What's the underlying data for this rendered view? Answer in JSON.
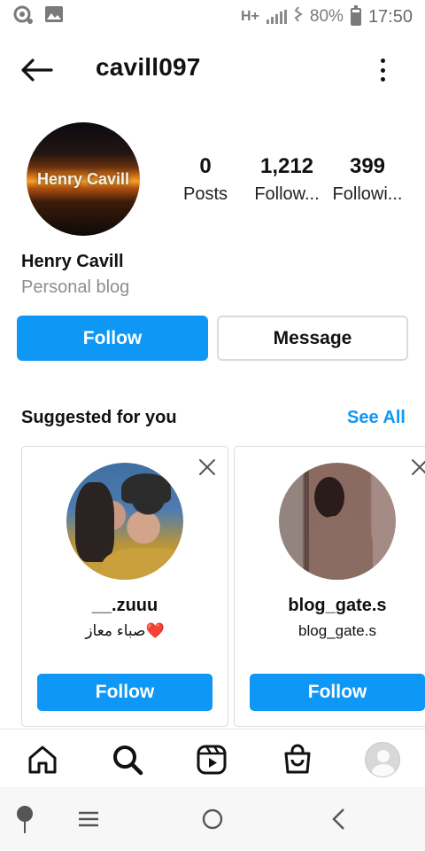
{
  "status_bar": {
    "network": "H+",
    "battery": "80%",
    "time": "17:50"
  },
  "header": {
    "username": "cavill097"
  },
  "profile": {
    "avatar_text": "Henry Cavill",
    "display_name": "Henry Cavill",
    "category": "Personal blog",
    "stats": [
      {
        "value": "0",
        "label": "Posts"
      },
      {
        "value": "1,212",
        "label": "Follow..."
      },
      {
        "value": "399",
        "label": "Followi..."
      }
    ],
    "follow_label": "Follow",
    "message_label": "Message"
  },
  "suggested": {
    "title": "Suggested for you",
    "see_all": "See All",
    "cards": [
      {
        "username": "__.zuuu",
        "subtitle": "صباء معاز❤️",
        "follow_label": "Follow"
      },
      {
        "username": "blog_gate.s",
        "subtitle": "blog_gate.s",
        "follow_label": "Follow"
      }
    ]
  },
  "colors": {
    "accent": "#0f97f5",
    "border": "#dbdbdb",
    "muted_text": "#8e8e8e"
  },
  "icons": {
    "status_left": [
      "camera-sync-icon",
      "image-icon"
    ],
    "status_right": [
      "signal-icon",
      "vibrate-icon",
      "battery-icon"
    ],
    "header": [
      "back-arrow-icon",
      "more-vertical-icon"
    ],
    "bottom_nav": [
      "home-icon",
      "search-icon",
      "reels-icon",
      "shop-icon",
      "profile-icon"
    ],
    "system_nav": [
      "pin-icon",
      "recent-apps-icon",
      "home-circle-icon",
      "back-chevron-icon"
    ]
  }
}
